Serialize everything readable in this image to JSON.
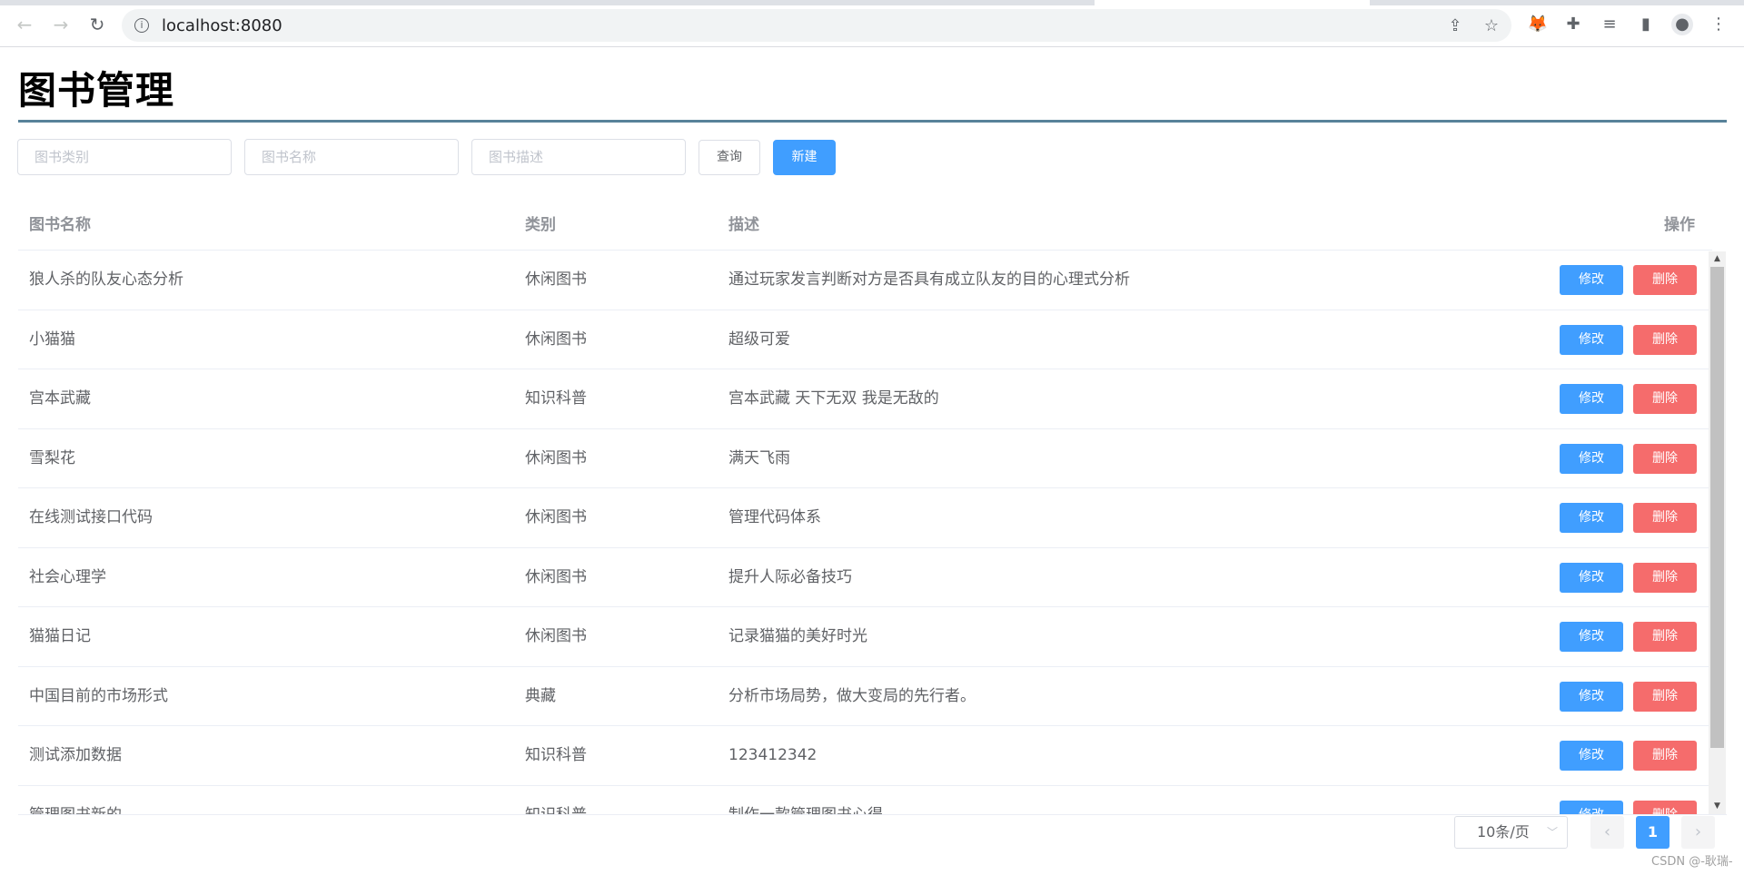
{
  "browser": {
    "url": "localhost:8080"
  },
  "page": {
    "title": "图书管理"
  },
  "search": {
    "category_placeholder": "图书类别",
    "name_placeholder": "图书名称",
    "description_placeholder": "图书描述",
    "query_label": "查询",
    "new_label": "新建"
  },
  "table": {
    "headers": {
      "name": "图书名称",
      "category": "类别",
      "description": "描述",
      "actions": "操作"
    },
    "edit_label": "修改",
    "delete_label": "删除",
    "rows": [
      {
        "name": "狼人杀的队友心态分析",
        "category": "休闲图书",
        "description": "通过玩家发言判断对方是否具有成立队友的目的心理式分析"
      },
      {
        "name": "小猫猫",
        "category": "休闲图书",
        "description": "超级可爱"
      },
      {
        "name": "宫本武藏",
        "category": "知识科普",
        "description": "宫本武藏 天下无双 我是无敌的"
      },
      {
        "name": "雪梨花",
        "category": "休闲图书",
        "description": "满天飞雨"
      },
      {
        "name": "在线测试接口代码",
        "category": "休闲图书",
        "description": "管理代码体系"
      },
      {
        "name": "社会心理学",
        "category": "休闲图书",
        "description": "提升人际必备技巧"
      },
      {
        "name": "猫猫日记",
        "category": "休闲图书",
        "description": "记录猫猫的美好时光"
      },
      {
        "name": "中国目前的市场形式",
        "category": "典藏",
        "description": "分析市场局势，做大变局的先行者。"
      },
      {
        "name": "测试添加数据",
        "category": "知识科普",
        "description": "123412342"
      },
      {
        "name": "管理图书新的",
        "category": "知识科普",
        "description": "制作一款管理图书心得"
      }
    ]
  },
  "pagination": {
    "page_size_label": "10条/页",
    "current_page": "1"
  },
  "watermark": "CSDN @-耿瑞-",
  "colors": {
    "primary": "#409eff",
    "danger": "#f56c6c",
    "title_rule": "#58829a"
  }
}
